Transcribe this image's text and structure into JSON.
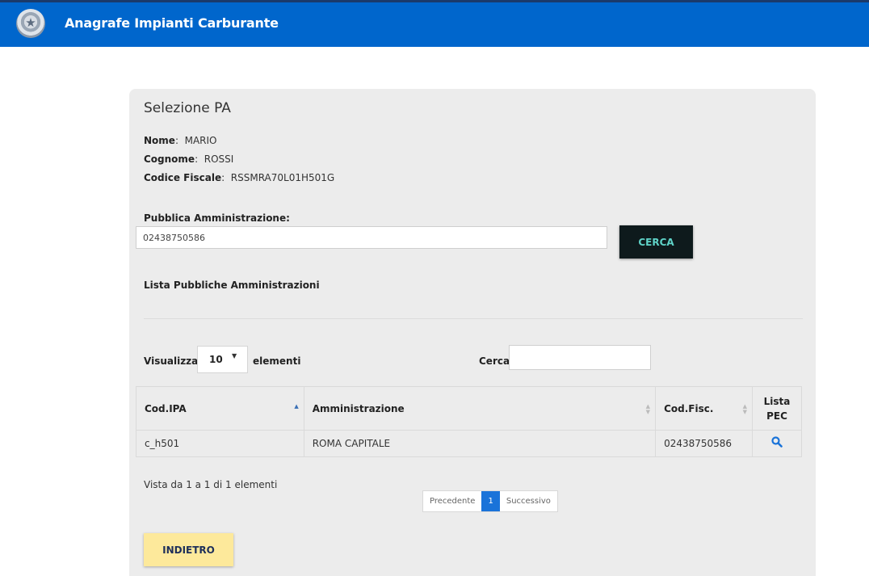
{
  "header": {
    "title": "Anagrafe Impianti Carburante",
    "emblem_icon": "italian-republic-emblem"
  },
  "panel": {
    "title": "Selezione PA",
    "nome_label": "Nome",
    "nome_value": "MARIO",
    "cognome_label": "Cognome",
    "cognome_value": "ROSSI",
    "cf_label": "Codice Fiscale",
    "cf_value": "RSSMRA70L01H501G",
    "pa_label": "Pubblica Amministrazione",
    "pa_value": "02438750586",
    "cerca_button": "CERCA",
    "lista_title": "Lista Pubbliche Amministrazioni"
  },
  "table_controls": {
    "visualizza_label": "Visualizza",
    "page_size": "10",
    "elementi_label": "elementi",
    "search_label": "Cerca:"
  },
  "table": {
    "headers": [
      "Cod.IPA",
      "Amministrazione",
      "Cod.Fisc.",
      "Lista PEC"
    ],
    "rows": [
      {
        "cod_ipa": "c_h501",
        "amministrazione": "ROMA CAPITALE",
        "cod_fisc": "02438750586",
        "lista_pec_icon": "search-icon"
      }
    ]
  },
  "footer": {
    "info": "Vista da 1 a 1 di 1 elementi",
    "prev": "Precedente",
    "current_page": "1",
    "next": "Successivo",
    "back_button": "INDIETRO"
  },
  "colors": {
    "header_bg": "#0066cc",
    "cerca_bg": "#0e1a1c",
    "back_bg": "#fde99b",
    "pager_active": "#1a73d9"
  }
}
